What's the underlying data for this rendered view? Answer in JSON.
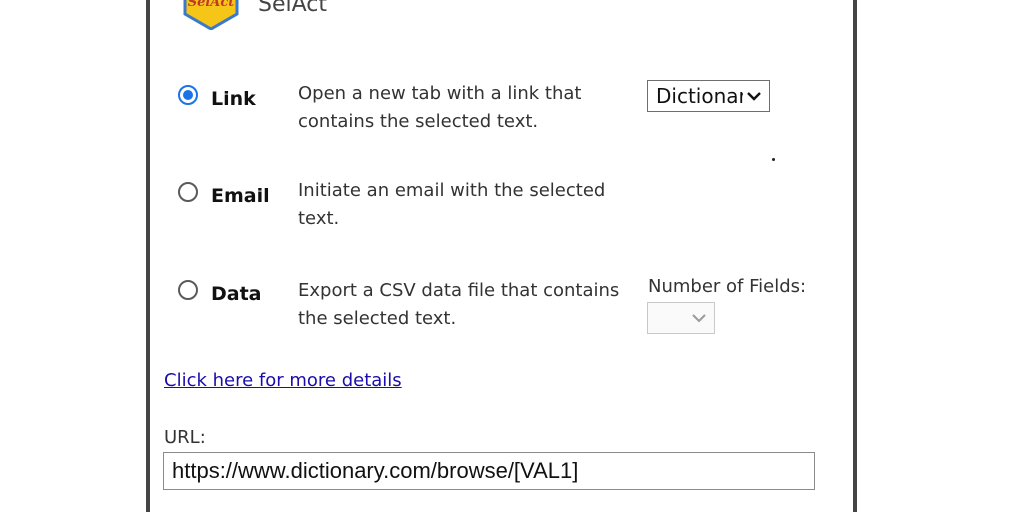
{
  "header": {
    "app_name": "SelAct",
    "logo_text": "SelAct"
  },
  "options": [
    {
      "label": "Link",
      "description": "Open a new tab with a link that contains the selected text.",
      "selected": true
    },
    {
      "label": "Email",
      "description": "Initiate an email with the selected text.",
      "selected": false
    },
    {
      "label": "Data",
      "description": "Export a CSV data file that contains the selected text.",
      "selected": false
    }
  ],
  "link_select": {
    "value": "Dictionary"
  },
  "data_fields": {
    "label": "Number of Fields:",
    "value": ""
  },
  "details_link": "Click here for more details",
  "url": {
    "label": "URL:",
    "value": "https://www.dictionary.com/browse/[VAL1]"
  },
  "colors": {
    "accent": "#1a73e8",
    "link": "#1a0dab",
    "logo_fill": "#f5c518",
    "logo_border": "#3a78c9"
  }
}
